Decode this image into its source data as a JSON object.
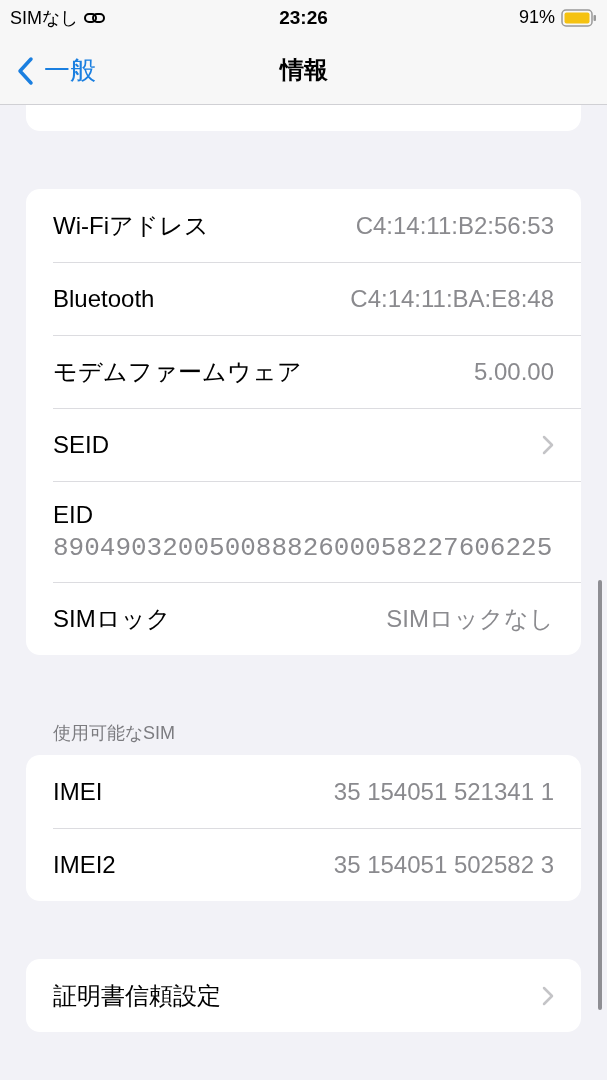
{
  "status_bar": {
    "carrier": "SIMなし",
    "time": "23:26",
    "battery_text": "91%"
  },
  "nav_bar": {
    "back_label": "一般",
    "title": "情報"
  },
  "groups": [
    {
      "partial": true
    },
    {
      "rows": [
        {
          "kind": "value",
          "label": "Wi-Fiアドレス",
          "value": "C4:14:11:B2:56:53"
        },
        {
          "kind": "value",
          "label": "Bluetooth",
          "value": "C4:14:11:BA:E8:48"
        },
        {
          "kind": "value",
          "label": "モデムファームウェア",
          "value": "5.00.00"
        },
        {
          "kind": "disclosure",
          "label": "SEID"
        },
        {
          "kind": "stacked",
          "label": "EID",
          "value": "89049032005008882600058227606225"
        },
        {
          "kind": "value",
          "label": "SIMロック",
          "value": "SIMロックなし"
        }
      ]
    },
    {
      "header": "使用可能なSIM",
      "rows": [
        {
          "kind": "value",
          "label": "IMEI",
          "value": "35 154051 521341 1"
        },
        {
          "kind": "value",
          "label": "IMEI2",
          "value": "35 154051 502582 3"
        }
      ]
    },
    {
      "rows": [
        {
          "kind": "disclosure",
          "label": "証明書信頼設定"
        }
      ]
    }
  ]
}
